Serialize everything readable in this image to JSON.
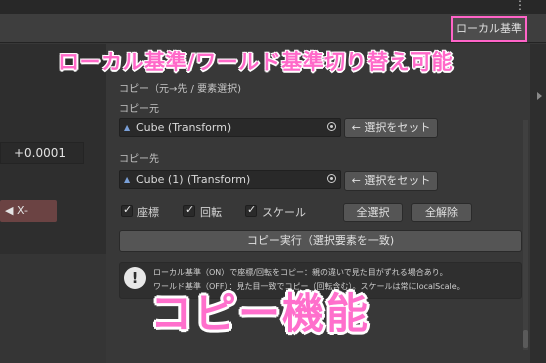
{
  "toolbar": {
    "kebab_label": "⋮",
    "local_world_button": "ローカル基準"
  },
  "annotations": {
    "top_caption": "ローカル基準/ワールド基準切り替え可能",
    "bottom_caption": "コピー機能"
  },
  "left_panel": {
    "value": "+0.0001",
    "axis_button": "◀ X-"
  },
  "copy_panel": {
    "section_title": "コピー（元→先 / 要素選択)",
    "source_label": "コピー元",
    "source_object": "Cube (Transform)",
    "source_set_button": "← 選択をセット",
    "dest_label": "コピー先",
    "dest_object": "Cube (1) (Transform)",
    "dest_set_button": "← 選択をセット",
    "checkboxes": [
      {
        "label": "座標",
        "checked": true
      },
      {
        "label": "回転",
        "checked": true
      },
      {
        "label": "スケール",
        "checked": true
      }
    ],
    "select_all_button": "全選択",
    "deselect_all_button": "全解除",
    "execute_button": "コピー実行（選択要素を一致)",
    "help_line1": "ローカル基準（ON）で座標/回転をコピー：親の違いで見た目がずれる場合あり。",
    "help_line2": "ワールド基準（OFF）：見た目一致でコピー（回転含む）。スケールは常にlocalScale。"
  },
  "icons": {
    "help": "exclamation-icon",
    "cube": "cube-icon",
    "picker": "object-picker-icon"
  },
  "colors": {
    "highlight": "#ff64c8",
    "axis_x": "#6b4343"
  }
}
